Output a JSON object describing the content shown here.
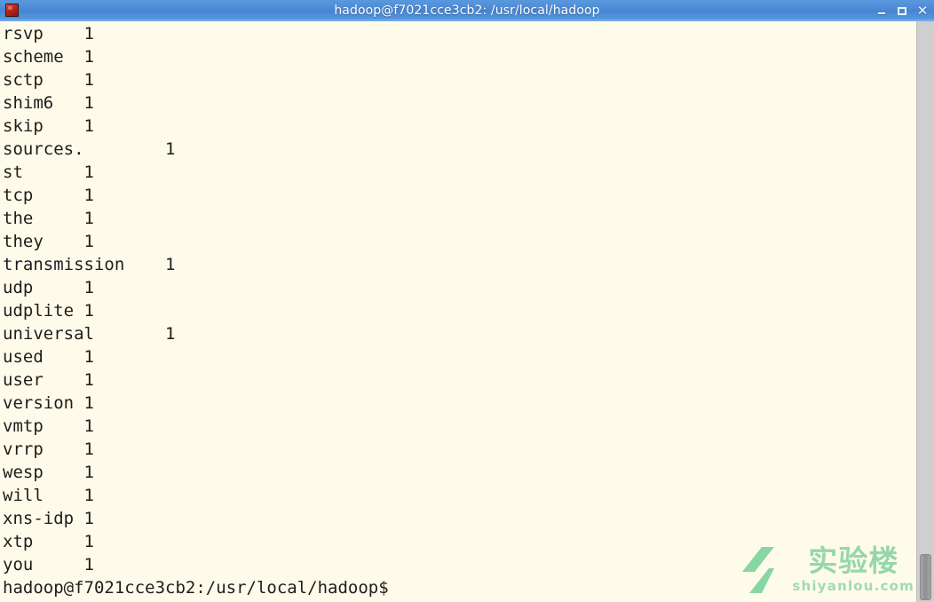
{
  "window": {
    "title": "hadoop@f7021cce3cb2: /usr/local/hadoop",
    "icon_name": "terminal-app-icon",
    "controls": {
      "minimize_label": "_",
      "maximize_label": "□",
      "close_label": "✕"
    },
    "titlebar_color": "#4a88d4",
    "background_color": "#FFFBEB",
    "text_color": "#1d1d1b"
  },
  "terminal": {
    "command_output_description": "word count output listing",
    "lines": [
      "rsvp\t1",
      "scheme\t1",
      "sctp\t1",
      "shim6\t1",
      "skip\t1",
      "sources.\t1",
      "st\t1",
      "tcp\t1",
      "the\t1",
      "they\t1",
      "transmission\t1",
      "udp\t1",
      "udplite\t1",
      "universal\t1",
      "used\t1",
      "user\t1",
      "version\t1",
      "vmtp\t1",
      "vrrp\t1",
      "wesp\t1",
      "will\t1",
      "xns-idp\t1",
      "xtp\t1",
      "you\t1"
    ],
    "word_counts": [
      {
        "word": "rsvp",
        "count": 1
      },
      {
        "word": "scheme",
        "count": 1
      },
      {
        "word": "sctp",
        "count": 1
      },
      {
        "word": "shim6",
        "count": 1
      },
      {
        "word": "skip",
        "count": 1
      },
      {
        "word": "sources.",
        "count": 1
      },
      {
        "word": "st",
        "count": 1
      },
      {
        "word": "tcp",
        "count": 1
      },
      {
        "word": "the",
        "count": 1
      },
      {
        "word": "they",
        "count": 1
      },
      {
        "word": "transmission",
        "count": 1
      },
      {
        "word": "udp",
        "count": 1
      },
      {
        "word": "udplite",
        "count": 1
      },
      {
        "word": "universal",
        "count": 1
      },
      {
        "word": "used",
        "count": 1
      },
      {
        "word": "user",
        "count": 1
      },
      {
        "word": "version",
        "count": 1
      },
      {
        "word": "vmtp",
        "count": 1
      },
      {
        "word": "vrrp",
        "count": 1
      },
      {
        "word": "wesp",
        "count": 1
      },
      {
        "word": "will",
        "count": 1
      },
      {
        "word": "xns-idp",
        "count": 1
      },
      {
        "word": "xtp",
        "count": 1
      },
      {
        "word": "you",
        "count": 1
      }
    ],
    "prompt": "hadoop@f7021cce3cb2:/usr/local/hadoop$"
  },
  "scrollbar": {
    "name": "vertical-scrollbar",
    "thumb_position": "bottom"
  },
  "watermark": {
    "logo_name": "shiyanlou-logo-icon",
    "cn_text": "实验楼",
    "en_text": "shiyanlou.com",
    "color": "#7ed09a"
  }
}
